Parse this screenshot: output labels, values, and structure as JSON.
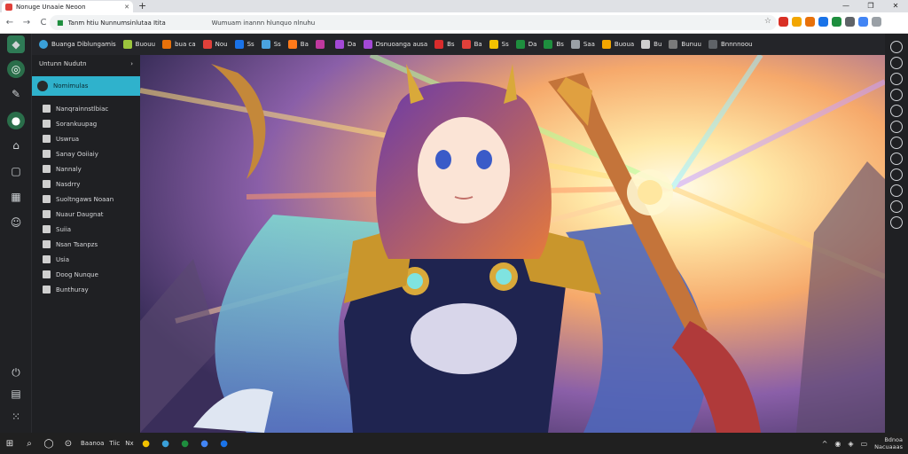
{
  "browser": {
    "tab_title": "Nonuge Unaaie Neoon",
    "new_tab": "+",
    "window_controls": [
      "—",
      "❐",
      "✕"
    ],
    "back": "←",
    "forward": "→",
    "reload": "C",
    "url": "Tanm htiu Nunnumsinlutaa Itita",
    "url_secondary": "Wumuam inannn hlunquo nlnuhu",
    "star": "☆",
    "ext_colors": [
      "#d93025",
      "#f2a600",
      "#e8710a",
      "#1a73e8",
      "#1e8e3e",
      "#5f6368",
      "#4285f4",
      "#9aa0a6"
    ]
  },
  "left_rail": {
    "icons": [
      "home-icon",
      "pen-icon",
      "globe-icon",
      "house-icon",
      "square-icon",
      "calendar-icon",
      "smile-icon",
      "power-icon",
      "folder-icon",
      "grid-icon"
    ]
  },
  "panel": {
    "header": "Untunn Nudutn",
    "header_chevron": "›",
    "active_item": "Nomimulas",
    "items": [
      "Nanqrainnstlbiac",
      "Sorankuupag",
      "Uswrua",
      "Sanay Ooiiaiy",
      "Nannaly",
      "Nasdrry",
      "Suoltngaws Noaan",
      "Nuaur Daugnat",
      "Suiia",
      "Nsan Tsanpzs",
      "Usia",
      "Doog Nunque",
      "Bunthuray"
    ]
  },
  "bookmarks": {
    "profile": "Buanga Diblungamis",
    "items": [
      {
        "label": "Buouu",
        "color": "#9bc53d"
      },
      {
        "label": "bua ca",
        "color": "#e8710a"
      },
      {
        "label": "Nou",
        "color": "#e0403a"
      },
      {
        "label": "Ss",
        "color": "#1a73e8"
      },
      {
        "label": "Ss",
        "color": "#4aa3df"
      },
      {
        "label": "Ba",
        "color": "#ff7a1a"
      },
      {
        "label": "",
        "color": "#c0399f"
      },
      {
        "label": "Da",
        "color": "#a349d6"
      },
      {
        "label": "Dsnuoanga ausa",
        "color": "#a349d6"
      },
      {
        "label": "Bs",
        "color": "#d92c2c"
      },
      {
        "label": "Ba",
        "color": "#e0403a"
      },
      {
        "label": "Ss",
        "color": "#f2c100"
      },
      {
        "label": "Da",
        "color": "#1e8e3e"
      },
      {
        "label": "Bs",
        "color": "#1e8e3e"
      },
      {
        "label": "Saa",
        "color": "#9aa0a6"
      },
      {
        "label": "Buoua",
        "color": "#f2a600"
      },
      {
        "label": "Bu",
        "color": "#cfcfcf"
      },
      {
        "label": "Bunuu",
        "color": "#7a7a7a"
      },
      {
        "label": "Bnnnnoou",
        "color": "#5f6368"
      }
    ]
  },
  "taskbar": {
    "items": [
      "Baanoa",
      "Tiic",
      "Nx"
    ],
    "clock_time": "Bdnoa",
    "clock_date": "Nacuaaas"
  }
}
